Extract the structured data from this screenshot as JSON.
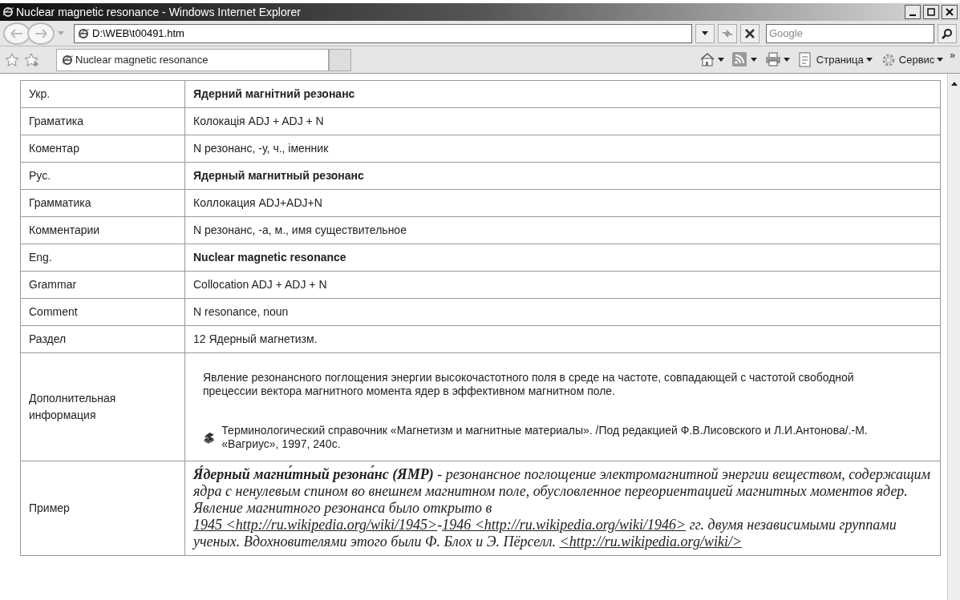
{
  "window": {
    "title": "Nuclear magnetic resonance - Windows Internet Explorer"
  },
  "address_bar": {
    "value": "D:\\WEB\\t00491.htm"
  },
  "search": {
    "placeholder": "Google"
  },
  "tabs": [
    {
      "label": "Nuclear magnetic resonance",
      "selected": true
    }
  ],
  "command_bar": {
    "items": [
      {
        "kind": "home"
      },
      {
        "kind": "feeds"
      },
      {
        "kind": "print"
      },
      {
        "kind": "page",
        "label": "Страница"
      },
      {
        "kind": "tools",
        "label": "Сервис"
      }
    ],
    "overflow": "»"
  },
  "table": {
    "rows": [
      {
        "label": "Укр.",
        "value": "Ядерний магнітний резонанс",
        "bold": true
      },
      {
        "label": "Граматика",
        "value": "Колокація ADJ + ADJ + N",
        "bold": false
      },
      {
        "label": "Коментар",
        "value": "N резонанс, -у, ч., іменник",
        "bold": false
      },
      {
        "label": "Рус.",
        "value": "Ядерный магнитный резонанс",
        "bold": true
      },
      {
        "label": "Грамматика",
        "value": "Коллокация ADJ+ADJ+N",
        "bold": false
      },
      {
        "label": "Комментарии",
        "value": "N резонанс, -а, м., имя существительное",
        "bold": false
      },
      {
        "label": "Eng.",
        "value": "Nuclear magnetic resonance",
        "bold": true
      },
      {
        "label": "Grammar",
        "value": "Collocation ADJ + ADJ + N",
        "bold": false
      },
      {
        "label": "Comment",
        "value": "N resonance, noun",
        "bold": false
      },
      {
        "label": "Раздел",
        "value": "12 Ядерный магнетизм.",
        "bold": false
      }
    ],
    "info": {
      "label": "Дополнительная информация",
      "text": "Явление резонансного поглощения энергии высокочастотного поля в среде на частоте, совпадающей с частотой свободной прецессии вектора магнитного момента ядер в эффективном магнитном поле.",
      "reference": "Терминологический справочник «Магнетизм и магнитные материалы». /Под редакцией Ф.В.Лисовского и Л.И.Антонова/.-М. «Вагриус», 1997, 240с."
    },
    "example": {
      "label": "Пример",
      "segments": [
        {
          "kind": "text",
          "text": "**Я́дерный магни́тный резона́нс (ЯМР)** - резонансное поглощение электромагнитной энергии веществом, содержащим ядра с ненулевым спином во внешнем магнитном поле, обусловленное переориентацией магнитных моментов ядер. Явление магнитного резонанса было открыто в "
        },
        {
          "kind": "link",
          "text": "1945 <http://ru.wikipedia.org/wiki/1945>"
        },
        {
          "kind": "text",
          "text": "-"
        },
        {
          "kind": "link",
          "text": "1946 <http://ru.wikipedia.org/wiki/1946>"
        },
        {
          "kind": "text",
          "text": " гг. двумя независимыми группами ученых. Вдохновителями этого были Ф. Блох и Э. Пёрселл. "
        },
        {
          "kind": "link",
          "text": "<http://ru.wikipedia.org/wiki/>"
        }
      ]
    }
  }
}
